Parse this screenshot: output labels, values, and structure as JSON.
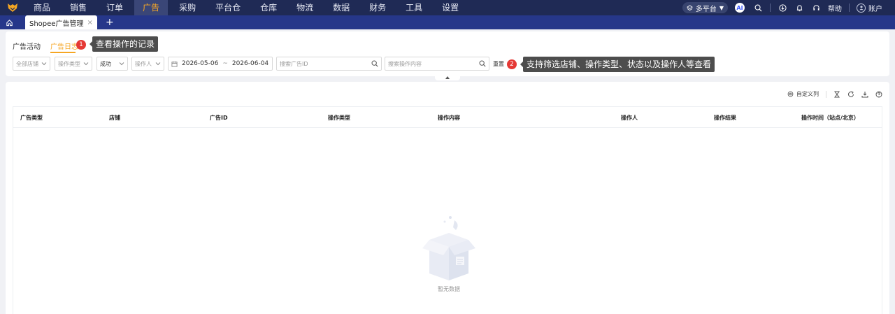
{
  "nav": {
    "items": [
      "商品",
      "销售",
      "订单",
      "广告",
      "采购",
      "平台仓",
      "仓库",
      "物流",
      "数据",
      "财务",
      "工具",
      "设置"
    ],
    "active_index": 3,
    "platform": "多平台",
    "ai": "AI",
    "help": "帮助",
    "account": "账户"
  },
  "tabs": {
    "page_tab": "Shopee广告管理",
    "close": "×",
    "add": "+"
  },
  "subtabs": {
    "activity": "广告活动",
    "log": "广告日志"
  },
  "callouts": [
    {
      "num": "1",
      "text": "查看操作的记录"
    },
    {
      "num": "2",
      "text": "支持筛选店铺、操作类型、状态以及操作人等查看"
    }
  ],
  "filters": {
    "store": "全部店铺",
    "op_type": "操作类型",
    "status": "成功",
    "operator": "操作人",
    "date_start": "2026-05-06",
    "date_sep": "~",
    "date_end": "2026-06-04",
    "search_ad_id": "搜索广告ID",
    "search_content": "搜索操作内容",
    "reset": "重置"
  },
  "tools": {
    "custom_columns": "自定义列"
  },
  "table": {
    "headers": [
      "广告类型",
      "店铺",
      "广告ID",
      "操作类型",
      "操作内容",
      "操作人",
      "操作结果",
      "操作时间（站点/北京）"
    ],
    "empty_text": "暂无数据"
  },
  "colors": {
    "nav_bg": "#1f2a55",
    "tabbar_bg": "#26378a",
    "accent": "#f5a623",
    "badge": "#e53935",
    "tooltip_bg": "#4d4d4d"
  }
}
